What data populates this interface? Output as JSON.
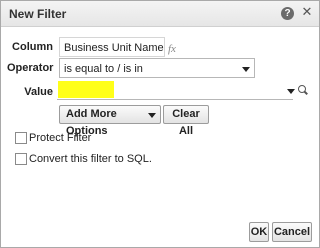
{
  "dialog": {
    "title": "New Filter",
    "help_icon": "?",
    "close_icon": "✕"
  },
  "form": {
    "column_label": "Column",
    "column_value": "Business Unit Name",
    "fx_icon": "fx",
    "operator_label": "Operator",
    "operator_value": "is equal to / is in",
    "value_label": "Value",
    "value_text": "",
    "add_more_options": "Add More Options",
    "clear_all": "Clear All"
  },
  "options": {
    "protect_filter": "Protect Filter",
    "convert_sql": "Convert this filter to SQL."
  },
  "footer": {
    "ok": "OK",
    "cancel": "Cancel"
  },
  "colors": {
    "highlight": "#ffff00"
  }
}
